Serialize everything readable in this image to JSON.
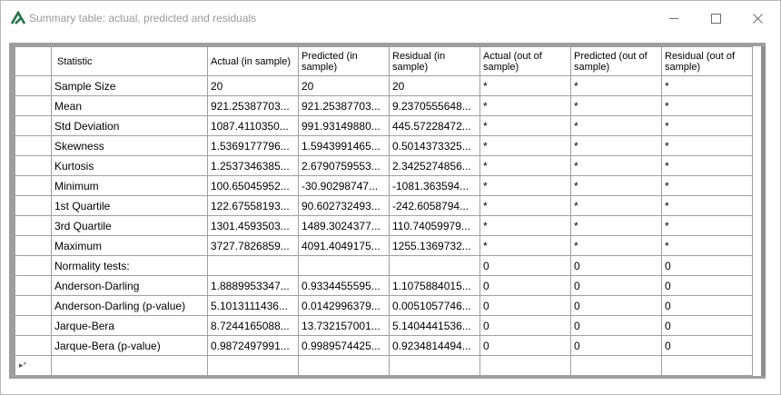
{
  "window": {
    "title": "Summary table: actual, predicted and residuals"
  },
  "table": {
    "columns": [
      "Statistic",
      "Actual (in sample)",
      "Predicted (in sample)",
      "Residual (in sample)",
      "Actual (out of sample)",
      "Predicted (out of sample)",
      "Residual (out of sample)"
    ],
    "rows": [
      [
        "Sample Size",
        "20",
        "20",
        "20",
        "*",
        "*",
        "*"
      ],
      [
        "Mean",
        "921.25387703...",
        "921.25387703...",
        "9.2370555648...",
        "*",
        "*",
        "*"
      ],
      [
        "Std Deviation",
        "1087.4110350...",
        "991.93149880...",
        "445.57228472...",
        "*",
        "*",
        "*"
      ],
      [
        "Skewness",
        "1.5369177796...",
        "1.5943991465...",
        "0.5014373325...",
        "*",
        "*",
        "*"
      ],
      [
        "Kurtosis",
        "1.2537346385...",
        "2.6790759553...",
        "2.3425274856...",
        "*",
        "*",
        "*"
      ],
      [
        "Minimum",
        "100.65045952...",
        "-30.90298747...",
        "-1081.363594...",
        "*",
        "*",
        "*"
      ],
      [
        "1st Quartile",
        "122.67558193...",
        "90.602732493...",
        "-242.6058794...",
        "*",
        "*",
        "*"
      ],
      [
        "3rd Quartile",
        "1301.4593503...",
        "1489.3024377...",
        "110.74059979...",
        "*",
        "*",
        "*"
      ],
      [
        "Maximum",
        "3727.7826859...",
        "4091.4049175...",
        "1255.1369732...",
        "*",
        "*",
        "*"
      ],
      [
        "Normality tests:",
        "",
        "",
        "",
        "0",
        "0",
        "0"
      ],
      [
        "Anderson-Darling",
        "1.8889953347...",
        "0.9334455595...",
        "1.1075884015...",
        "0",
        "0",
        "0"
      ],
      [
        "Anderson-Darling (p-value)",
        "5.1013111436...",
        "0.0142996379...",
        "0.0051057746...",
        "0",
        "0",
        "0"
      ],
      [
        "Jarque-Bera",
        "8.7244165088...",
        "13.732157001...",
        "5.1404441536...",
        "0",
        "0",
        "0"
      ],
      [
        "Jarque-Bera (p-value)",
        "0.9872497991...",
        "0.9989574425...",
        "0.9234814494...",
        "0",
        "0",
        "0"
      ]
    ],
    "new_row_marker": "▸*"
  },
  "icons": {
    "app": "xlstat-logo-icon",
    "minimize": "minimize-icon",
    "maximize": "maximize-icon",
    "close": "close-icon"
  },
  "colors": {
    "accent": "#217346"
  }
}
